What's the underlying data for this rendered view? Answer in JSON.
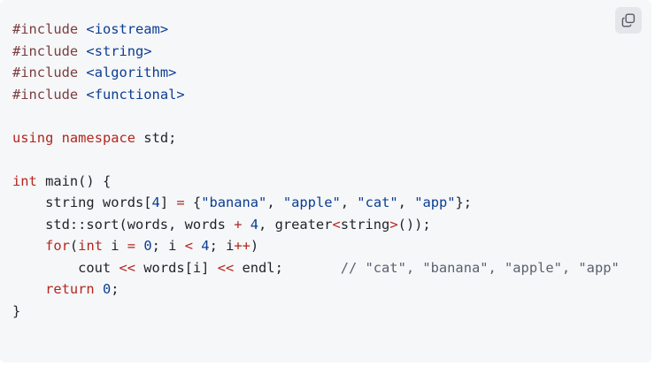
{
  "code": {
    "lines": [
      [
        {
          "c": "kw-pp",
          "t": "#include"
        },
        {
          "c": "txt",
          "t": " "
        },
        {
          "c": "str",
          "t": "<iostream>"
        }
      ],
      [
        {
          "c": "kw-pp",
          "t": "#include"
        },
        {
          "c": "txt",
          "t": " "
        },
        {
          "c": "str",
          "t": "<string>"
        }
      ],
      [
        {
          "c": "kw-pp",
          "t": "#include"
        },
        {
          "c": "txt",
          "t": " "
        },
        {
          "c": "str",
          "t": "<algorithm>"
        }
      ],
      [
        {
          "c": "kw-pp",
          "t": "#include"
        },
        {
          "c": "txt",
          "t": " "
        },
        {
          "c": "str",
          "t": "<functional>"
        }
      ],
      [],
      [
        {
          "c": "kw",
          "t": "using"
        },
        {
          "c": "txt",
          "t": " "
        },
        {
          "c": "kw",
          "t": "namespace"
        },
        {
          "c": "txt",
          "t": " std;"
        }
      ],
      [],
      [
        {
          "c": "kw",
          "t": "int"
        },
        {
          "c": "txt",
          "t": " main() {"
        }
      ],
      [
        {
          "c": "txt",
          "t": "    string words["
        },
        {
          "c": "num",
          "t": "4"
        },
        {
          "c": "txt",
          "t": "] "
        },
        {
          "c": "op",
          "t": "="
        },
        {
          "c": "txt",
          "t": " {"
        },
        {
          "c": "str",
          "t": "\"banana\""
        },
        {
          "c": "txt",
          "t": ", "
        },
        {
          "c": "str",
          "t": "\"apple\""
        },
        {
          "c": "txt",
          "t": ", "
        },
        {
          "c": "str",
          "t": "\"cat\""
        },
        {
          "c": "txt",
          "t": ", "
        },
        {
          "c": "str",
          "t": "\"app\""
        },
        {
          "c": "txt",
          "t": "};"
        }
      ],
      [
        {
          "c": "txt",
          "t": "    std::sort(words, words "
        },
        {
          "c": "op",
          "t": "+"
        },
        {
          "c": "txt",
          "t": " "
        },
        {
          "c": "num",
          "t": "4"
        },
        {
          "c": "txt",
          "t": ", greater"
        },
        {
          "c": "op",
          "t": "<"
        },
        {
          "c": "txt",
          "t": "string"
        },
        {
          "c": "op",
          "t": ">"
        },
        {
          "c": "txt",
          "t": "());"
        }
      ],
      [
        {
          "c": "txt",
          "t": "    "
        },
        {
          "c": "kw",
          "t": "for"
        },
        {
          "c": "txt",
          "t": "("
        },
        {
          "c": "kw",
          "t": "int"
        },
        {
          "c": "txt",
          "t": " i "
        },
        {
          "c": "op",
          "t": "="
        },
        {
          "c": "txt",
          "t": " "
        },
        {
          "c": "num",
          "t": "0"
        },
        {
          "c": "txt",
          "t": "; i "
        },
        {
          "c": "op",
          "t": "<"
        },
        {
          "c": "txt",
          "t": " "
        },
        {
          "c": "num",
          "t": "4"
        },
        {
          "c": "txt",
          "t": "; i"
        },
        {
          "c": "op",
          "t": "++"
        },
        {
          "c": "txt",
          "t": ")"
        }
      ],
      [
        {
          "c": "txt",
          "t": "        cout "
        },
        {
          "c": "op",
          "t": "<<"
        },
        {
          "c": "txt",
          "t": " words[i] "
        },
        {
          "c": "op",
          "t": "<<"
        },
        {
          "c": "txt",
          "t": " endl;       "
        },
        {
          "c": "cmt",
          "t": "// \"cat\", \"banana\", \"apple\", \"app\""
        }
      ],
      [
        {
          "c": "txt",
          "t": "    "
        },
        {
          "c": "kw",
          "t": "return"
        },
        {
          "c": "txt",
          "t": " "
        },
        {
          "c": "num",
          "t": "0"
        },
        {
          "c": "txt",
          "t": ";"
        }
      ],
      [
        {
          "c": "txt",
          "t": "}"
        }
      ]
    ]
  },
  "toolbar": {
    "copy_icon": "copy-icon",
    "icon_color": "#555b66"
  },
  "colors": {
    "panel_bg": "#f6f7f9",
    "button_bg": "#e4e6ea"
  }
}
